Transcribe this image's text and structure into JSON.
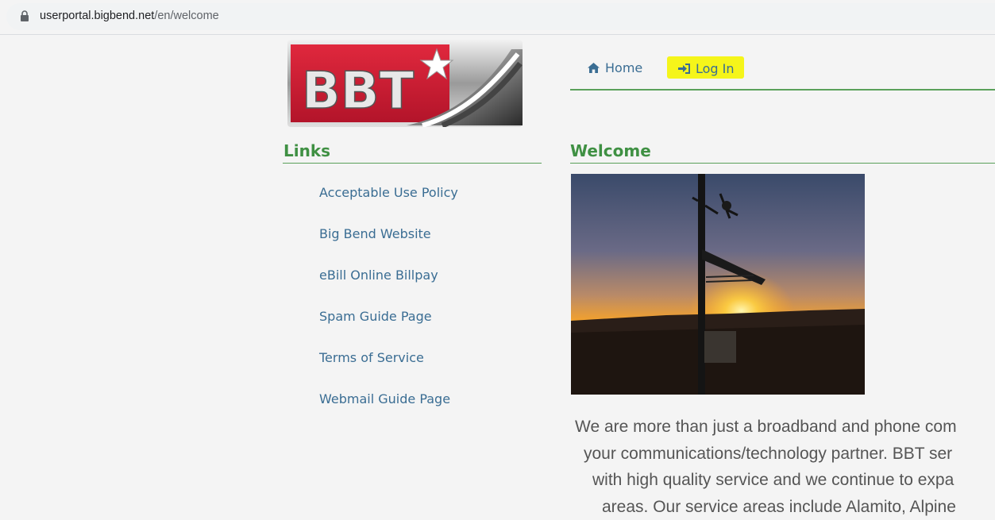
{
  "browser": {
    "url_host": "userportal.bigbend.net",
    "url_path": "/en/welcome"
  },
  "logo": {
    "text": "BBT"
  },
  "nav": {
    "home_label": "Home",
    "login_label": "Log In"
  },
  "links": {
    "title": "Links",
    "items": [
      "Acceptable Use Policy",
      "Big Bend Website",
      "eBill Online Billpay",
      "Spam Guide Page",
      "Terms of Service",
      "Webmail Guide Page"
    ]
  },
  "welcome": {
    "title": "Welcome",
    "lines": [
      "We are more than just a broadband and phone com",
      "your communications/technology partner. BBT ser",
      "with high quality service and we continue to expa",
      "areas. Our service areas include Alamito, Alpine"
    ]
  },
  "colors": {
    "accent_green": "#3f9043",
    "link_blue": "#3a6d93",
    "highlight_yellow": "#f5f51a",
    "logo_red": "#d31f36"
  }
}
